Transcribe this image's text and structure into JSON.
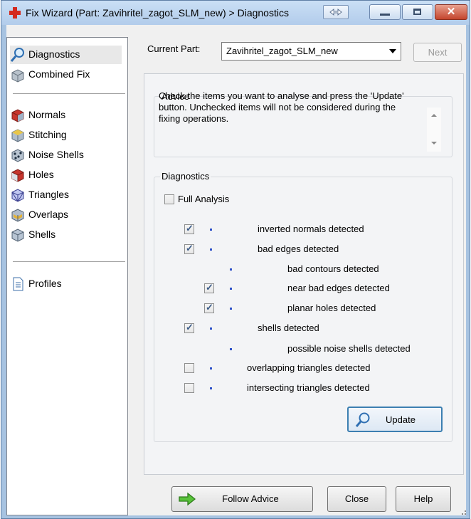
{
  "window": {
    "title": "Fix Wizard (Part: Zavihritel_zagot_SLM_new) > Diagnostics",
    "close_glyph": "✕"
  },
  "sidebar": {
    "group1": [
      {
        "label": "Diagnostics",
        "icon": "magnifier-icon",
        "selected": true
      },
      {
        "label": "Combined Fix",
        "icon": "combined-fix-icon"
      }
    ],
    "group2": [
      {
        "label": "Normals",
        "icon": "normals-cube-icon"
      },
      {
        "label": "Stitching",
        "icon": "stitching-cube-icon"
      },
      {
        "label": "Noise Shells",
        "icon": "noise-shells-icon"
      },
      {
        "label": "Holes",
        "icon": "holes-cube-icon"
      },
      {
        "label": "Triangles",
        "icon": "triangles-cube-icon"
      },
      {
        "label": "Overlaps",
        "icon": "overlaps-cube-icon"
      },
      {
        "label": "Shells",
        "icon": "shells-cube-icon"
      }
    ],
    "group3": [
      {
        "label": "Profiles",
        "icon": "profile-document-icon"
      }
    ]
  },
  "header": {
    "current_part_label": "Current Part:",
    "current_part_value": "Zavihritel_zagot_SLM_new",
    "next_label": "Next"
  },
  "advice": {
    "title": "Advice",
    "text": "Check the items you want to analyse and press the 'Update' button. Unchecked items will not be considered during the fixing operations."
  },
  "diagnostics": {
    "title": "Diagnostics",
    "full_analysis_label": "Full Analysis",
    "full_analysis_checked": false,
    "items": [
      {
        "label": "inverted normals detected",
        "checked": true,
        "has_checkbox": true,
        "level": 0
      },
      {
        "label": "bad edges detected",
        "checked": true,
        "has_checkbox": true,
        "level": 0
      },
      {
        "label": "bad contours detected",
        "checked": false,
        "has_checkbox": false,
        "level": 1
      },
      {
        "label": "near bad edges detected",
        "checked": true,
        "has_checkbox": true,
        "level": 1
      },
      {
        "label": "planar holes detected",
        "checked": true,
        "has_checkbox": true,
        "level": 1
      },
      {
        "label": "shells detected",
        "checked": true,
        "has_checkbox": true,
        "level": 0
      },
      {
        "label": "possible noise shells detected",
        "checked": false,
        "has_checkbox": false,
        "level": 1
      },
      {
        "label": "overlapping triangles detected",
        "checked": false,
        "has_checkbox": true,
        "level": 0
      },
      {
        "label": "intersecting triangles detected",
        "checked": false,
        "has_checkbox": true,
        "level": 0
      }
    ],
    "update_label": "Update"
  },
  "footer": {
    "follow_advice_label": "Follow Advice",
    "close_label": "Close",
    "help_label": "Help"
  },
  "colors": {
    "accent_blue": "#3c7fb1",
    "bullet_blue": "#2d50c8",
    "close_red": "#c4452d"
  }
}
